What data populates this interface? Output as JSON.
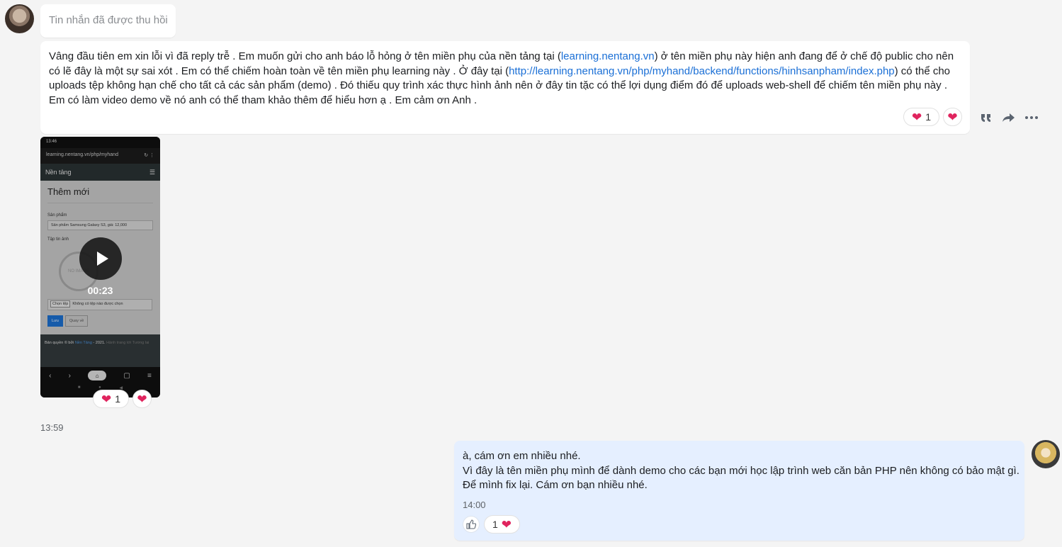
{
  "incoming": {
    "recalled_text": "Tin nhắn đã được thu hồi",
    "message": {
      "part1": "Vâng đầu tiên em xin lỗi vì đã reply trễ . Em muốn gửi cho anh báo lỗ hỏng ở tên miền phụ của nền tảng tại (",
      "link1": "learning.nentang.vn",
      "part2": ") ở tên miền phụ này hiện anh đang để ở chế độ public cho nên có lẽ đây là một sự sai xót . Em có thể chiếm hoàn toàn về tên miền phụ learning này . Ở đây tại (",
      "link2": "http://learning.nentang.vn/php/myhand/backend/functions/hinhsanpham/index.php",
      "part3": ") có thể cho uploads tệp không hạn chế cho tất cả các sản phẩm (demo) . Đó thiếu quy trình xác thực hình ảnh nên ở đây tin tặc có thể lợi dụng điểm đó để uploads web-shell để chiếm tên miền phụ này . Em có làm video demo về nó anh có thể tham khảo thêm để hiểu hơn ạ . Em cảm ơn Anh ."
    },
    "message_reaction_count": "1",
    "video": {
      "status_time": "13:46",
      "url": "learning.nentang.vn/php/myhand",
      "nav_title": "Nền tảng",
      "page_heading": "Thêm mới",
      "field_product": "Sản phẩm",
      "product_value": "Sản phẩm Samsung Galaxy S3, giá: 12,000",
      "field_image": "Tập tin ảnh",
      "no_image": "NO IMAGE",
      "file_button": "Chọn tệp",
      "file_status": "Không có tệp nào được chọn",
      "save_label": "Lưu",
      "back_label": "Quay về",
      "footer_prefix": "Bản quyền © bởi ",
      "footer_link": "Nền Tảng",
      "footer_mid": " - 2021. ",
      "footer_muted": "Hành trang tới Tương lai",
      "duration": "00:23"
    },
    "video_reaction_count": "1",
    "timestamp": "13:59"
  },
  "outgoing": {
    "lines": [
      "à, cám ơn em nhiều nhé.",
      "Vì đây là tên miền phụ mình để dành demo cho các bạn mới học lập trình web căn bản PHP nên không có bảo mật gì.",
      "Để mình fix lại. Cám ơn bạn nhiều nhé."
    ],
    "timestamp": "14:00",
    "reaction_count": "1"
  },
  "icons": [
    "quote-icon",
    "share-icon",
    "more-icon",
    "heart-icon",
    "like-icon",
    "play-icon"
  ],
  "colors": {
    "link": "#1a6fd6",
    "heart": "#e0245e",
    "outgoing_bubble": "#e5efff"
  }
}
